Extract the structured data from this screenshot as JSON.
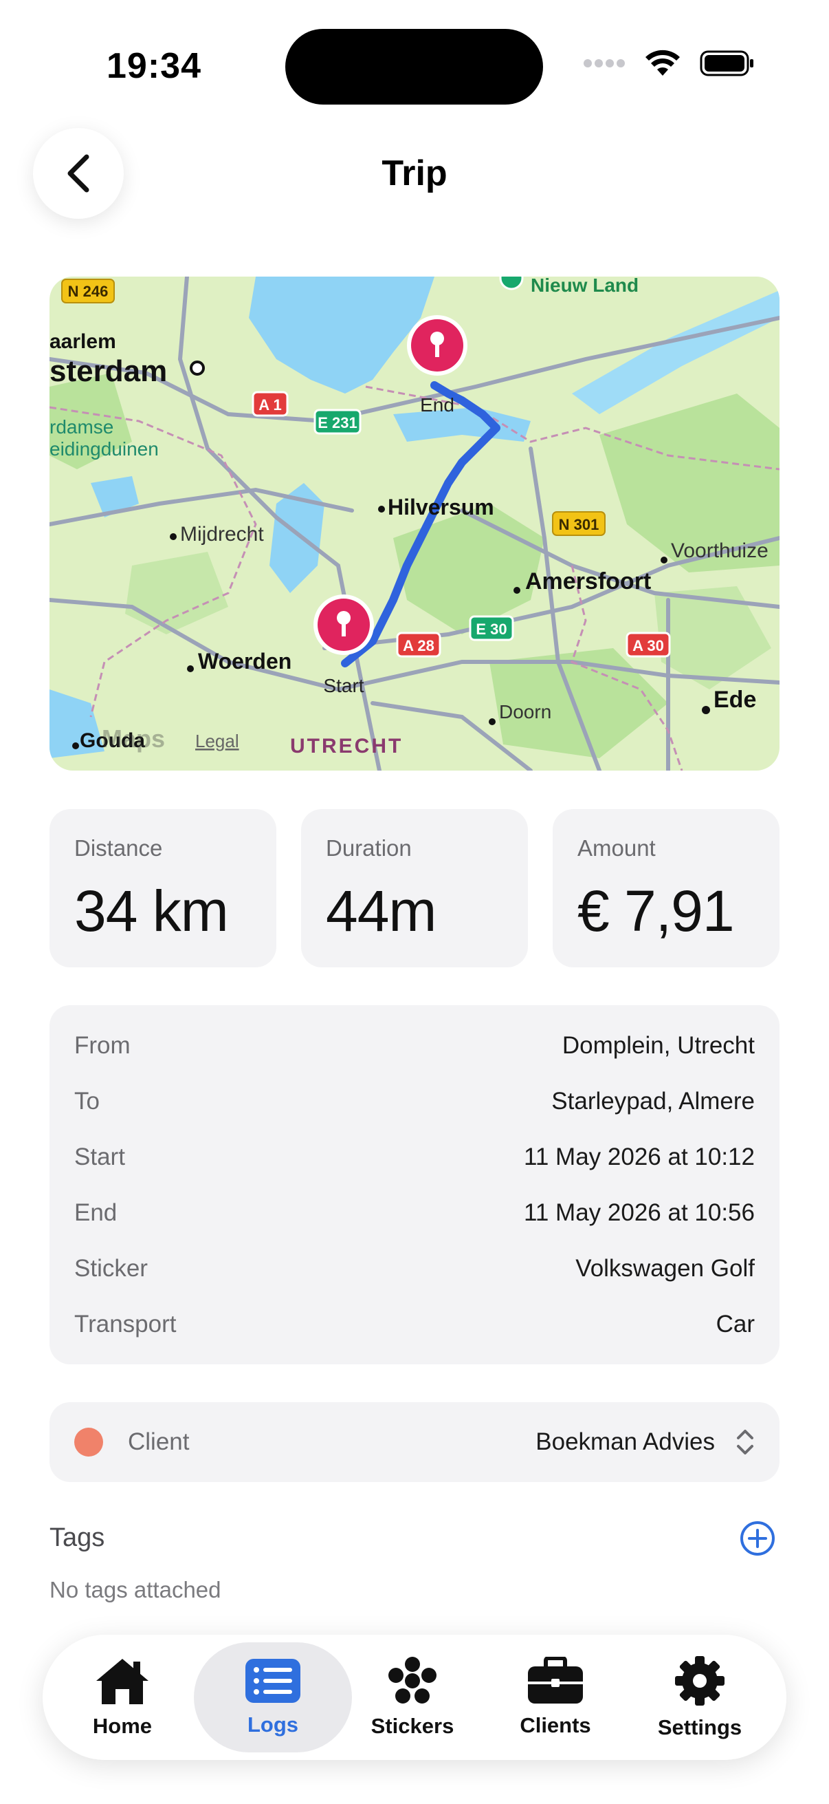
{
  "status_bar": {
    "time": "19:34"
  },
  "nav": {
    "title": "Trip"
  },
  "map": {
    "labels": {
      "n246": "N 246",
      "nieuw_land": "Nieuw Land",
      "haarlem": "aarlem",
      "amsterdam": "sterdam",
      "dunes_1": "rdamse",
      "dunes_2": "eidingduinen",
      "a1": "A 1",
      "e231": "E 231",
      "end": "End",
      "hilversum": "Hilversum",
      "mijdrecht": "Mijdrecht",
      "n301": "N 301",
      "voorthuizen": "Voorthuize",
      "amersfoort": "Amersfoort",
      "e30": "E 30",
      "a28": "A 28",
      "a30": "A 30",
      "woerden": "Woerden",
      "start": "Start",
      "ede": "Ede",
      "doorn": "Doorn",
      "gouda": "Gouda",
      "maps": "Maps",
      "legal": "Legal",
      "utrecht": "UTRECHT"
    },
    "colors": {
      "route": "#2f63dd",
      "pin": "#e0245e",
      "land": "#dff0c3",
      "water": "#8fd3f5",
      "forest": "#b9e29b",
      "road": "#9ba3b8"
    }
  },
  "stats": [
    {
      "label": "Distance",
      "value": "34 km"
    },
    {
      "label": "Duration",
      "value": "44m"
    },
    {
      "label": "Amount",
      "value": "€ 7,91"
    }
  ],
  "details": [
    {
      "key": "From",
      "value": "Domplein, Utrecht"
    },
    {
      "key": "To",
      "value": "Starleypad, Almere"
    },
    {
      "key": "Start",
      "value": "11 May 2026 at 10:12"
    },
    {
      "key": "End",
      "value": "11 May 2026 at 10:56"
    },
    {
      "key": "Sticker",
      "value": "Volkswagen Golf"
    },
    {
      "key": "Transport",
      "value": "Car"
    }
  ],
  "client": {
    "label": "Client",
    "value": "Boekman Advies",
    "dot_color": "#f0826a"
  },
  "tags": {
    "title": "Tags",
    "empty": "No tags attached"
  },
  "tabs": [
    {
      "label": "Home",
      "icon": "house-icon"
    },
    {
      "label": "Logs",
      "icon": "list-icon",
      "active": true
    },
    {
      "label": "Stickers",
      "icon": "flower-icon"
    },
    {
      "label": "Clients",
      "icon": "briefcase-icon"
    },
    {
      "label": "Settings",
      "icon": "gear-icon"
    }
  ],
  "accent": "#2f6fde"
}
